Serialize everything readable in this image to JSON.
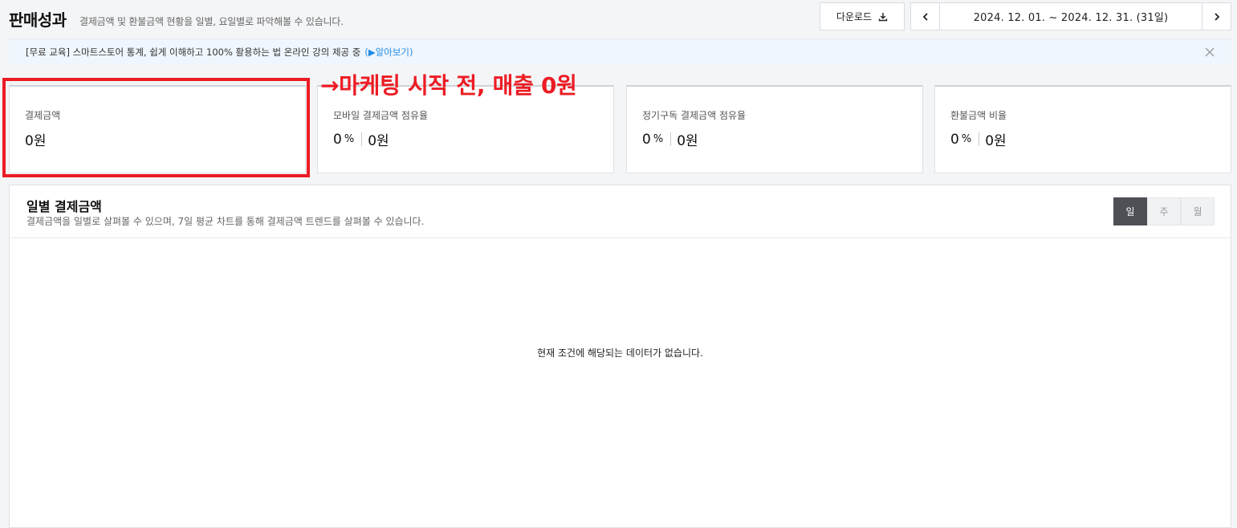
{
  "header": {
    "title": "판매성과",
    "description": "결제금액 및 환불금액 현황을 일별, 요일별로 파악해볼 수 있습니다.",
    "download_label": "다운로드",
    "date_range": "2024. 12. 01. ~ 2024. 12. 31. (31일)"
  },
  "notice": {
    "text": "[무료 교육] 스마트스토어 통계, 쉽게 이해하고 100% 활용하는 법 온라인 강의 제공 중",
    "link": "(▶알아보기)"
  },
  "annotation": "→마케팅 시작 전, 매출 0원",
  "stats": [
    {
      "label": "결제금액",
      "value": "0원"
    },
    {
      "label": "모바일 결제금액 점유율",
      "pct": "0",
      "pct_unit": "%",
      "value": "0원"
    },
    {
      "label": "정기구독 결제금액 점유율",
      "pct": "0",
      "pct_unit": "%",
      "value": "0원"
    },
    {
      "label": "환불금액 비율",
      "pct": "0",
      "pct_unit": "%",
      "value": "0원"
    }
  ],
  "daily": {
    "title": "일별 결제금액",
    "description": "결제금액을 일별로 살펴볼 수 있으며, 7일 평균 차트를 통해 결제금액 트렌드를 살펴볼 수 있습니다.",
    "tabs": [
      {
        "label": "일",
        "active": true
      },
      {
        "label": "주",
        "active": false
      },
      {
        "label": "월",
        "active": false
      }
    ],
    "empty_message": "현재 조건에 해당되는 데이터가 없습니다."
  },
  "colors": {
    "annotation": "#ec1c24",
    "link": "#1f8ce6",
    "active_tab": "#4d5156"
  }
}
